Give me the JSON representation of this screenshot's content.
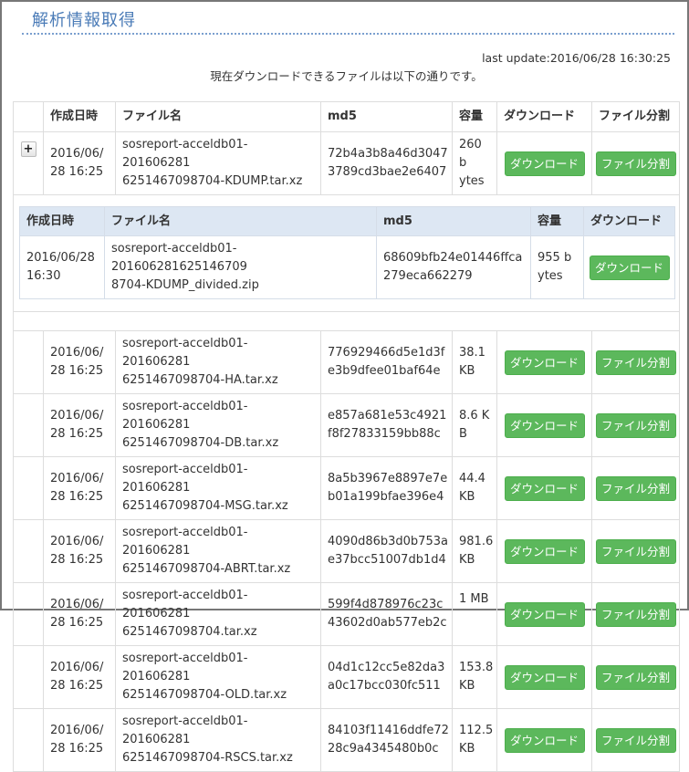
{
  "page": {
    "title": "解析情報取得",
    "last_update": "last update:2016/06/28 16:30:25",
    "notice": "現在ダウンロードできるファイルは以下の通りです。"
  },
  "table": {
    "headers": {
      "date": "作成日時",
      "filename": "ファイル名",
      "md5": "md5",
      "size": "容量",
      "download": "ダウンロード",
      "split": "ファイル分割"
    },
    "expand_icon": "+",
    "rows": [
      {
        "date_l1": "2016/06/",
        "date_l2": "28 16:25",
        "name_l1": "sosreport-acceldb01-201606281",
        "name_l2": "6251467098704-KDUMP.tar.xz",
        "md5_l1": "72b4a3b8a46d3047",
        "md5_l2": "3789cd3bae2e6407",
        "size_l1": "260 b",
        "size_l2": "ytes",
        "download_label": "ダウンロード",
        "split_label": "ファイル分割"
      },
      {
        "date_l1": "2016/06/",
        "date_l2": "28 16:25",
        "name_l1": "sosreport-acceldb01-201606281",
        "name_l2": "6251467098704-HA.tar.xz",
        "md5_l1": "776929466d5e1d3f",
        "md5_l2": "e3b9dfee01baf64e",
        "size_l1": "38.1",
        "size_l2": "KB",
        "download_label": "ダウンロード",
        "split_label": "ファイル分割"
      },
      {
        "date_l1": "2016/06/",
        "date_l2": "28 16:25",
        "name_l1": "sosreport-acceldb01-201606281",
        "name_l2": "6251467098704-DB.tar.xz",
        "md5_l1": "e857a681e53c4921",
        "md5_l2": "f8f27833159bb88c",
        "size_l1": "8.6 K",
        "size_l2": "B",
        "download_label": "ダウンロード",
        "split_label": "ファイル分割"
      },
      {
        "date_l1": "2016/06/",
        "date_l2": "28 16:25",
        "name_l1": "sosreport-acceldb01-201606281",
        "name_l2": "6251467098704-MSG.tar.xz",
        "md5_l1": "8a5b3967e8897e7e",
        "md5_l2": "b01a199bfae396e4",
        "size_l1": "44.4",
        "size_l2": "KB",
        "download_label": "ダウンロード",
        "split_label": "ファイル分割"
      },
      {
        "date_l1": "2016/06/",
        "date_l2": "28 16:25",
        "name_l1": "sosreport-acceldb01-201606281",
        "name_l2": "6251467098704-ABRT.tar.xz",
        "md5_l1": "4090d86b3d0b753a",
        "md5_l2": "e37bcc51007db1d4",
        "size_l1": "981.6",
        "size_l2": "KB",
        "download_label": "ダウンロード",
        "split_label": "ファイル分割"
      },
      {
        "date_l1": "2016/06/",
        "date_l2": "28 16:25",
        "name_l1": "sosreport-acceldb01-201606281",
        "name_l2": "6251467098704.tar.xz",
        "md5_l1": "599f4d878976c23c",
        "md5_l2": "43602d0ab577eb2c",
        "size_l1": "1 MB",
        "size_l2": "",
        "download_label": "ダウンロード",
        "split_label": "ファイル分割"
      },
      {
        "date_l1": "2016/06/",
        "date_l2": "28 16:25",
        "name_l1": "sosreport-acceldb01-201606281",
        "name_l2": "6251467098704-OLD.tar.xz",
        "md5_l1": "04d1c12cc5e82da3",
        "md5_l2": "a0c17bcc030fc511",
        "size_l1": "153.8",
        "size_l2": "KB",
        "download_label": "ダウンロード",
        "split_label": "ファイル分割"
      },
      {
        "date_l1": "2016/06/",
        "date_l2": "28 16:25",
        "name_l1": "sosreport-acceldb01-201606281",
        "name_l2": "6251467098704-RSCS.tar.xz",
        "md5_l1": "84103f11416ddfe72",
        "md5_l2": "28c9a4345480b0c",
        "size_l1": "112.5",
        "size_l2": "KB",
        "download_label": "ダウンロード",
        "split_label": "ファイル分割"
      }
    ]
  },
  "divided": {
    "headers": {
      "date": "作成日時",
      "filename": "ファイル名",
      "md5": "md5",
      "size": "容量",
      "download": "ダウンロード"
    },
    "row": {
      "date_l1": "2016/06/28",
      "date_l2": "16:30",
      "name_l1": "sosreport-acceldb01-201606281625146709",
      "name_l2": "8704-KDUMP_divided.zip",
      "md5_l1": "68609bfb24e01446ffca",
      "md5_l2": "279eca662279",
      "size_l1": "955 b",
      "size_l2": "ytes",
      "download_label": "ダウンロード"
    }
  },
  "colors": {
    "title": "#4a7bb7",
    "button_green": "#5cb85c",
    "sub_header_bg": "#dde7f3"
  }
}
